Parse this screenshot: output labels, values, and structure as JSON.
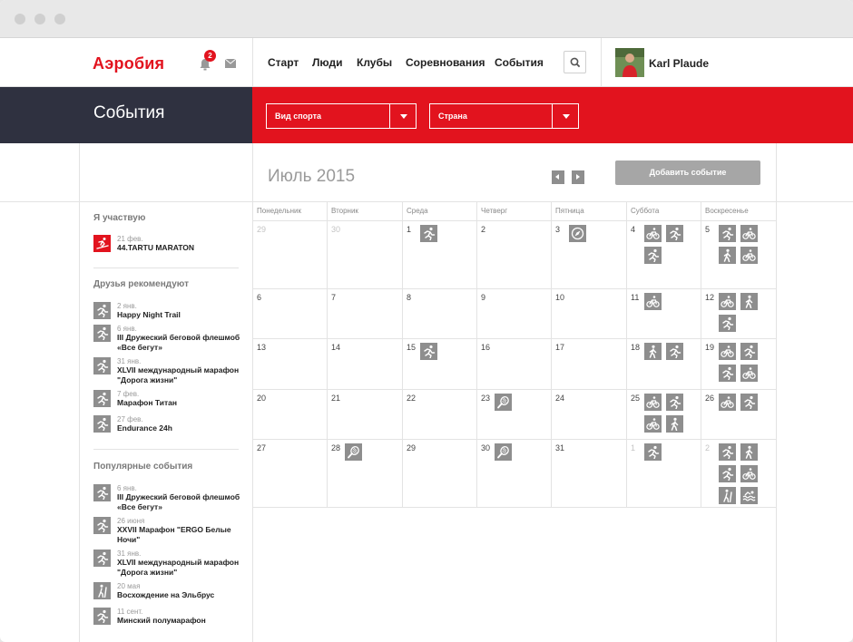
{
  "brand": {
    "logo": "Аэробия",
    "notif_count": "2"
  },
  "nav": [
    "Старт",
    "Люди",
    "Клубы",
    "Соревнования",
    "События"
  ],
  "user": {
    "name": "Karl Plaude"
  },
  "banner": {
    "title": "События"
  },
  "filters": {
    "sport": "Вид спорта",
    "country": "Страна"
  },
  "calendar": {
    "month": "Июль 2015",
    "add_button": "Добавить событие",
    "weekdays": [
      "Понедельник",
      "Вторник",
      "Среда",
      "Четверг",
      "Пятница",
      "Суббота",
      "Воскресенье"
    ],
    "weeks": [
      [
        {
          "d": "29",
          "m": true,
          "e": []
        },
        {
          "d": "30",
          "m": true,
          "e": []
        },
        {
          "d": "1",
          "e": [
            "run"
          ]
        },
        {
          "d": "2",
          "e": []
        },
        {
          "d": "3",
          "e": [
            "orient"
          ]
        },
        {
          "d": "4",
          "e": [
            "bike",
            "run",
            "run"
          ]
        },
        {
          "d": "5",
          "e": [
            "run",
            "bike",
            "walk",
            "bike"
          ]
        }
      ],
      [
        {
          "d": "6",
          "e": []
        },
        {
          "d": "7",
          "e": []
        },
        {
          "d": "8",
          "e": []
        },
        {
          "d": "9",
          "e": []
        },
        {
          "d": "10",
          "e": []
        },
        {
          "d": "11",
          "e": [
            "bike"
          ]
        },
        {
          "d": "12",
          "e": [
            "bike",
            "walk",
            "run"
          ]
        }
      ],
      [
        {
          "d": "13",
          "e": []
        },
        {
          "d": "14",
          "e": []
        },
        {
          "d": "15",
          "e": [
            "run"
          ]
        },
        {
          "d": "16",
          "e": []
        },
        {
          "d": "17",
          "e": []
        },
        {
          "d": "18",
          "e": [
            "walk",
            "run"
          ]
        },
        {
          "d": "19",
          "e": [
            "bike",
            "run",
            "run",
            "bike"
          ]
        }
      ],
      [
        {
          "d": "20",
          "e": []
        },
        {
          "d": "21",
          "e": []
        },
        {
          "d": "22",
          "e": []
        },
        {
          "d": "23",
          "e": [
            "tennis"
          ]
        },
        {
          "d": "24",
          "e": []
        },
        {
          "d": "25",
          "e": [
            "bike",
            "run",
            "bike",
            "walk"
          ]
        },
        {
          "d": "26",
          "e": [
            "bike",
            "run"
          ]
        }
      ],
      [
        {
          "d": "27",
          "e": []
        },
        {
          "d": "28",
          "e": [
            "tennis"
          ]
        },
        {
          "d": "29",
          "e": []
        },
        {
          "d": "30",
          "e": [
            "tennis"
          ]
        },
        {
          "d": "31",
          "e": []
        },
        {
          "d": "1",
          "m": true,
          "e": [
            "run"
          ]
        },
        {
          "d": "2",
          "m": true,
          "e": [
            "run",
            "walk",
            "run",
            "bike",
            "hike",
            "swim"
          ]
        }
      ]
    ]
  },
  "sidebar": {
    "participating": {
      "title": "Я участвую",
      "items": [
        {
          "date": "21 фев.",
          "name": "44.TARTU MARATON",
          "icon": "ski"
        }
      ]
    },
    "friends": {
      "title": "Друзья рекомендуют",
      "items": [
        {
          "date": "2 янв.",
          "name": "Happy Night Trail",
          "icon": "run"
        },
        {
          "date": "6 янв.",
          "name": "III Дружеский беговой флешмоб «Все бегут»",
          "icon": "run"
        },
        {
          "date": "31 янв.",
          "name": "XLVII международный марафон \"Дорога жизни\"",
          "icon": "run"
        },
        {
          "date": "7 фев.",
          "name": "Марафон Титан",
          "icon": "run"
        },
        {
          "date": "27 фев.",
          "name": "Endurance 24h",
          "icon": "run"
        }
      ]
    },
    "popular": {
      "title": "Популярные события",
      "items": [
        {
          "date": "6 янв.",
          "name": "III Дружеский беговой флешмоб «Все бегут»",
          "icon": "run"
        },
        {
          "date": "26 июня",
          "name": "XXVII Марафон \"ERGO Белые Ночи\"",
          "icon": "run"
        },
        {
          "date": "31 янв.",
          "name": "XLVII международный марафон \"Дорога жизни\"",
          "icon": "run"
        },
        {
          "date": "20 мая",
          "name": "Восхождение на Эльбрус",
          "icon": "hike"
        },
        {
          "date": "11 сент.",
          "name": "Минский полумарафон",
          "icon": "run"
        }
      ]
    }
  }
}
